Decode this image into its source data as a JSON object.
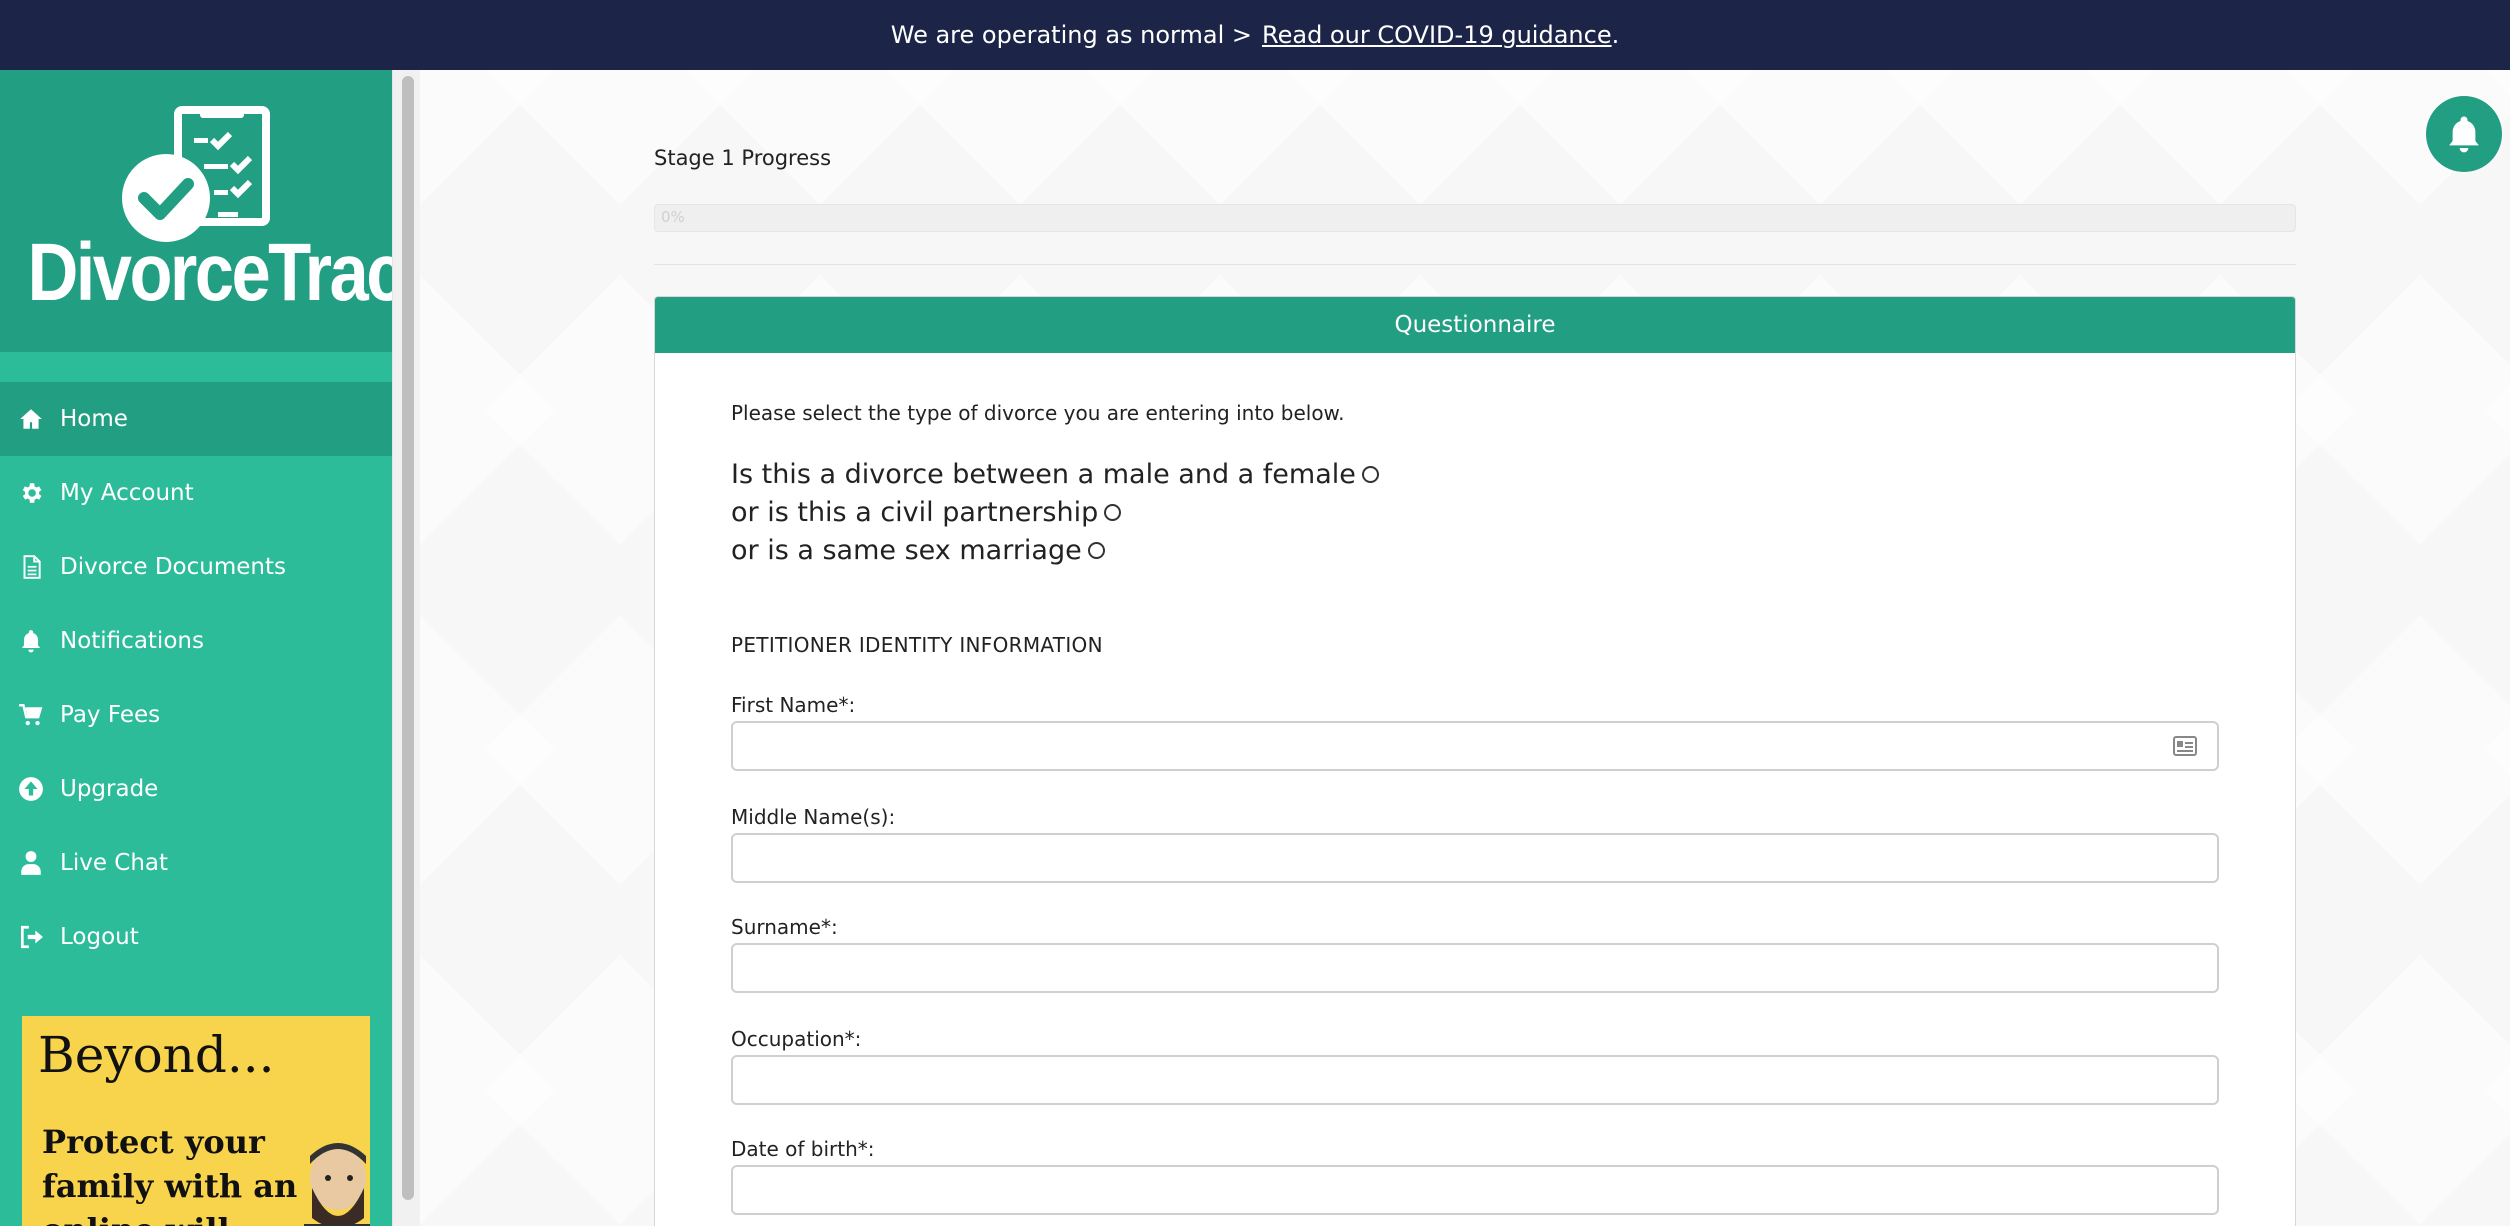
{
  "banner": {
    "text": "We are operating as normal >",
    "link": "Read our COVID-19 guidance",
    "suffix": "."
  },
  "sidebar": {
    "brand": "DivorceTrack",
    "items": [
      {
        "label": "Home",
        "icon": "home-icon",
        "active": true
      },
      {
        "label": "My Account",
        "icon": "gear-icon"
      },
      {
        "label": "Divorce Documents",
        "icon": "document-icon"
      },
      {
        "label": "Notifications",
        "icon": "bell-icon"
      },
      {
        "label": "Pay Fees",
        "icon": "cart-icon"
      },
      {
        "label": "Upgrade",
        "icon": "upgrade-icon"
      },
      {
        "label": "Live Chat",
        "icon": "user-icon"
      },
      {
        "label": "Logout",
        "icon": "logout-icon"
      }
    ],
    "ad": {
      "title": "Beyond...",
      "text": "Protect your family with an online will"
    }
  },
  "progress": {
    "label": "Stage 1 Progress",
    "value_text": "0%",
    "percent": 0
  },
  "questionnaire": {
    "title": "Questionnaire",
    "intro": "Please select the type of divorce you are entering into below.",
    "options": [
      "Is this a divorce between a male and a female",
      "or is this a civil partnership",
      "or is a same sex marriage"
    ],
    "section_title": "PETITIONER IDENTITY INFORMATION",
    "fields": [
      {
        "label": "First Name*:",
        "value": ""
      },
      {
        "label": "Middle Name(s):",
        "value": ""
      },
      {
        "label": "Surname*:",
        "value": ""
      },
      {
        "label": "Occupation*:",
        "value": ""
      },
      {
        "label": "Date of birth*:",
        "value": ""
      }
    ]
  },
  "colors": {
    "banner": "#1c2547",
    "sidebar": "#2cbc9a",
    "accent": "#229e82",
    "ad": "#f8d44c"
  }
}
